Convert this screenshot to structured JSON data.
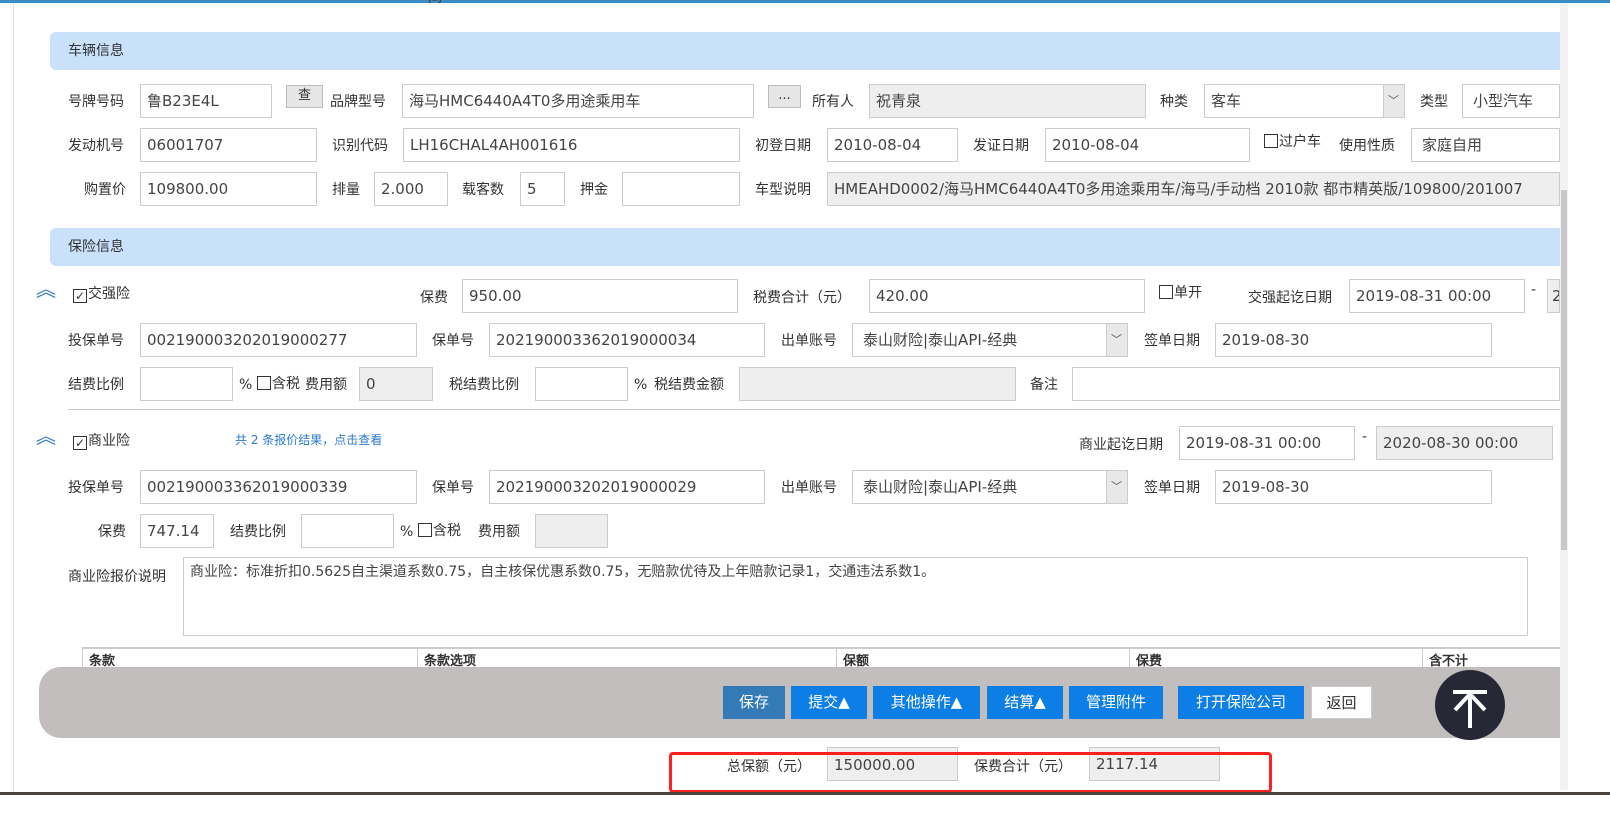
{
  "top_cut_text": "间",
  "vehicle": {
    "section_title": "车辆信息",
    "plate_label": "号牌号码",
    "plate": "鲁B23E4L",
    "lookup_btn": "查",
    "brand_label": "品牌型号",
    "brand": "海马HMC6440A4T0多用途乘用车",
    "more_btn": "...",
    "owner_label": "所有人",
    "owner": "祝青泉",
    "kind_label": "种类",
    "kind": "客车",
    "type_label": "类型",
    "type": "小型汽车",
    "engine_label": "发动机号",
    "engine": "06001707",
    "vin_label": "识别代码",
    "vin": "LH16CHAL4AH001616",
    "reg_date_label": "初登日期",
    "reg_date": "2010-08-04",
    "issue_date_label": "发证日期",
    "issue_date": "2010-08-04",
    "transfer_label": "过户车",
    "usage_label": "使用性质",
    "usage": "家庭自用",
    "price_label": "购置价",
    "price": "109800.00",
    "displacement_label": "排量",
    "displacement": "2.000",
    "seats_label": "载客数",
    "seats": "5",
    "deposit_label": "押金",
    "deposit": "",
    "model_desc_label": "车型说明",
    "model_desc": "HMEAHD0002/海马HMC6440A4T0多用途乘用车/海马/手动档 2010款 都市精英版/109800/201007"
  },
  "insurance": {
    "section_title": "保险信息",
    "compulsory": {
      "label": "交强险",
      "checked": true,
      "premium_label": "保费",
      "premium": "950.00",
      "tax_label": "税费合计（元）",
      "tax": "420.00",
      "single_label": "单开",
      "period_label": "交强起讫日期",
      "start": "2019-08-31 00:00",
      "dash": "-",
      "end": "2",
      "app_no_label": "投保单号",
      "app_no": "002190003202019000277",
      "policy_no_label": "保单号",
      "policy_no": "202190003362019000034",
      "account_label": "出单账号",
      "account": "泰山财险|泰山API-经典",
      "sign_date_label": "签单日期",
      "sign_date": "2019-08-30",
      "fee_ratio_label": "结费比例",
      "pct": "%",
      "tax_incl_label": "含税",
      "fee_amount_label": "费用额",
      "fee_amount": "0",
      "tax_fee_ratio_label": "税结费比例",
      "tax_fee_amount_label": "税结费金额",
      "remark_label": "备注"
    },
    "commercial": {
      "label": "商业险",
      "checked": true,
      "quote_link": "共 2 条报价结果，点击查看",
      "period_label": "商业起讫日期",
      "start": "2019-08-31 00:00",
      "dash": "-",
      "end": "2020-08-30 00:00",
      "app_no_label": "投保单号",
      "app_no": "002190003362019000339",
      "policy_no_label": "保单号",
      "policy_no": "202190003202019000029",
      "account_label": "出单账号",
      "account": "泰山财险|泰山API-经典",
      "sign_date_label": "签单日期",
      "sign_date": "2019-08-30",
      "premium_label": "保费",
      "premium": "747.14",
      "fee_ratio_label": "结费比例",
      "pct": "%",
      "tax_incl_label": "含税",
      "fee_amount_label": "费用额",
      "quote_desc_label": "商业险报价说明",
      "quote_desc": "商业险：标准折扣0.5625自主渠道系数0.75，自主核保优惠系数0.75，无赔款优待及上年赔款记录1，交通违法系数1。"
    },
    "table_headers": [
      "条款",
      "条款选项",
      "保额",
      "保费",
      "含不计"
    ]
  },
  "toolbar": {
    "save": "保存",
    "submit": "提交▲",
    "other": "其他操作▲",
    "settle": "结算▲",
    "attachments": "管理附件",
    "open_company": "打开保险公司",
    "back": "返回"
  },
  "totals": {
    "sum_insured_label": "总保额（元）",
    "sum_insured": "150000.00",
    "premium_total_label": "保费合计（元）",
    "premium_total": "2117.14"
  },
  "colors": {
    "save": "#337ab7",
    "primary": "#0d7ee6",
    "highlight": "#ff2020",
    "section": "#c9e1fb"
  }
}
